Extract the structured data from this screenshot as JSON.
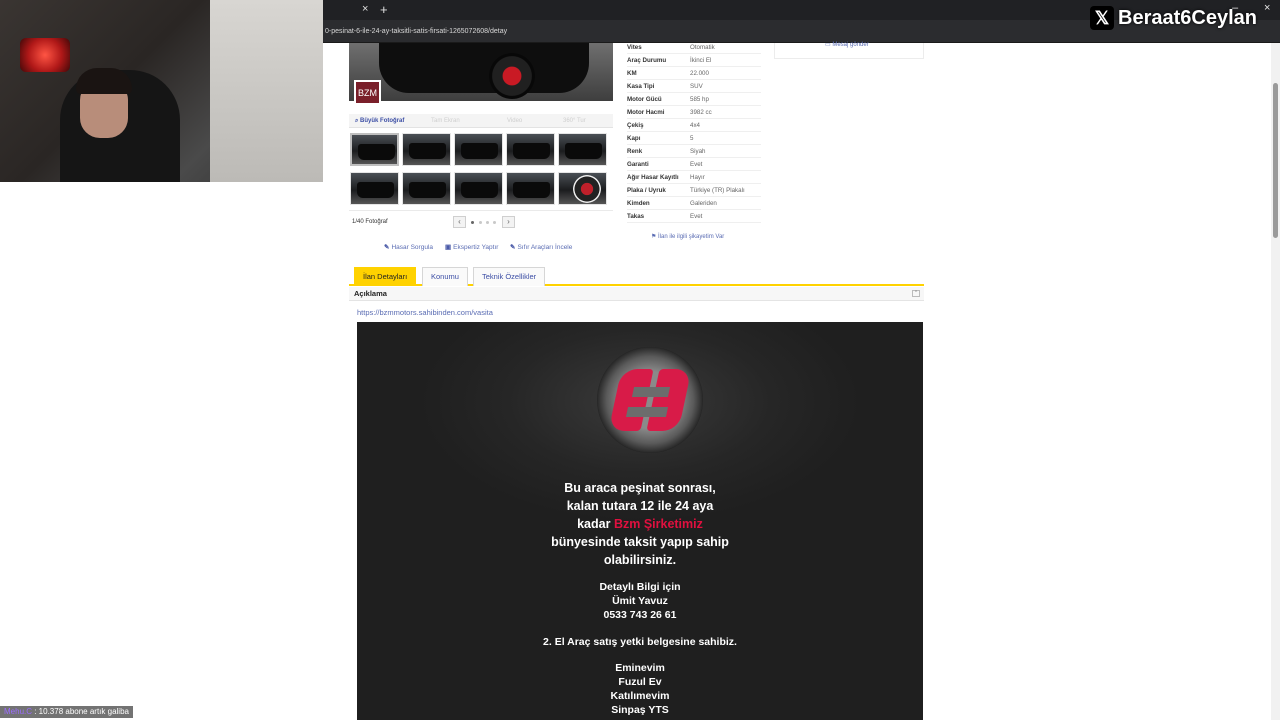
{
  "browser": {
    "url": "0-pesinat-6-ile-24-ay-taksitli-satis-firsati-1265072608/detay",
    "tab_close": "×",
    "new_tab": "+",
    "minimize": "–",
    "close": "×"
  },
  "overlay": {
    "watermark": "Beraat6Ceylan",
    "ticker_nick": "Mehu.C",
    "ticker_text": " : 10.378 abone artık galiba"
  },
  "gallery": {
    "dealer_badge": "BZM",
    "tabs": [
      {
        "label": "Büyük Fotoğraf"
      },
      {
        "label": "Tam Ekran"
      },
      {
        "label": "Video"
      },
      {
        "label": "360° Tur"
      }
    ],
    "photo_count": "1/40 Fotoğraf",
    "prev": "‹",
    "next": "›"
  },
  "actions": [
    {
      "icon": "✎",
      "label": "Hasar Sorgula"
    },
    {
      "icon": "▣",
      "label": "Ekspertiz Yaptır"
    },
    {
      "icon": "✎",
      "label": "Sıfır Araçları İncele"
    }
  ],
  "specs": [
    {
      "key": "Vites",
      "value": "Otomatik"
    },
    {
      "key": "Araç Durumu",
      "value": "İkinci El"
    },
    {
      "key": "KM",
      "value": "22.000"
    },
    {
      "key": "Kasa Tipi",
      "value": "SUV"
    },
    {
      "key": "Motor Gücü",
      "value": "585 hp"
    },
    {
      "key": "Motor Hacmi",
      "value": "3982 cc"
    },
    {
      "key": "Çekiş",
      "value": "4x4"
    },
    {
      "key": "Kapı",
      "value": "5"
    },
    {
      "key": "Renk",
      "value": "Siyah"
    },
    {
      "key": "Garanti",
      "value": "Evet"
    },
    {
      "key": "Ağır Hasar Kayıtlı",
      "value": "Hayır"
    },
    {
      "key": "Plaka / Uyruk",
      "value": "Türkiye (TR) Plakalı"
    },
    {
      "key": "Kimden",
      "value": "Galeriden"
    },
    {
      "key": "Takas",
      "value": "Evet"
    }
  ],
  "complaint": "İlan ile ilgili şikayetim Var",
  "message_send": "Mesaj gönder",
  "tabs": [
    {
      "label": "İlan Detayları"
    },
    {
      "label": "Konumu"
    },
    {
      "label": "Teknik Özellikler"
    }
  ],
  "description": {
    "title": "Açıklama",
    "link": "https://bzmmotors.sahibinden.com/vasita",
    "banner": {
      "line1": "Bu araca peşinat sonrası,",
      "line2": "kalan tutara 12 ile 24 aya",
      "line3_prefix": "kadar ",
      "line3_accent": "Bzm Şirketimiz",
      "line4": "bünyesinde taksit yapıp sahip",
      "line5": "olabilirsiniz.",
      "contact1": "Detaylı Bilgi için",
      "contact2": "Ümit Yavuz",
      "contact3": "0533 743 26 61",
      "cert": "2. El Araç satış yetki belgesine sahibiz.",
      "partners": [
        "Eminevim",
        "Fuzul Ev",
        "Katılımevim",
        "Sinpaş YTS"
      ]
    }
  },
  "colors": {
    "accent_yellow": "#ffd200",
    "link_blue": "#5a6cb3",
    "brand_red": "#d81b48"
  }
}
